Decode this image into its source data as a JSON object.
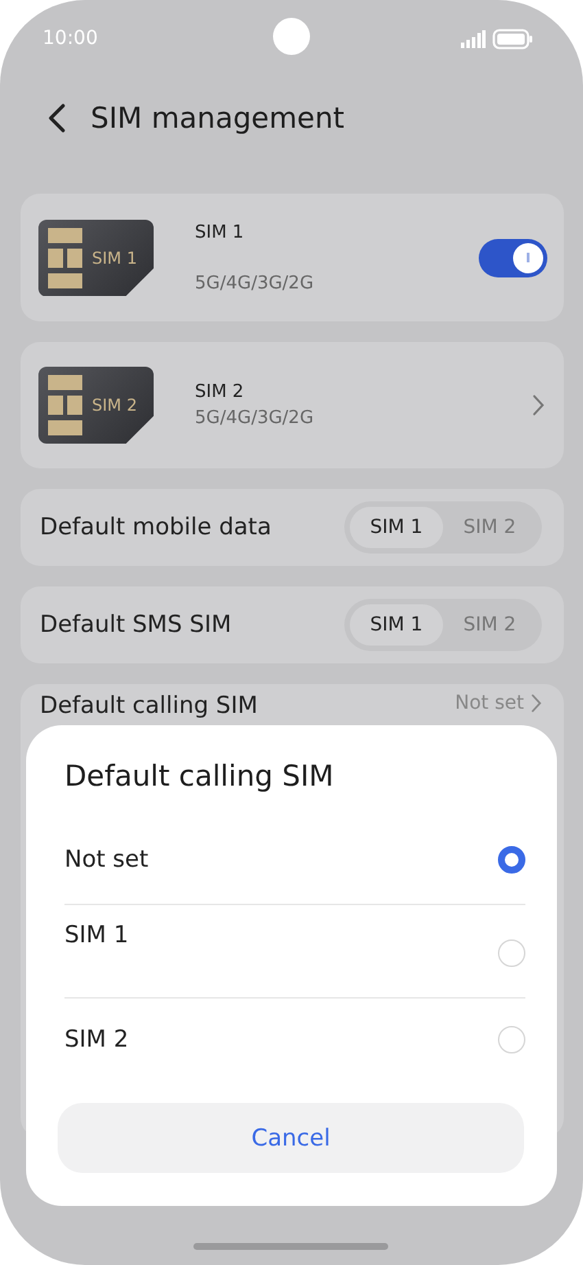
{
  "status_bar": {
    "time": "10:00"
  },
  "header": {
    "title": "SIM management"
  },
  "sims": [
    {
      "kind": "toggle",
      "card_label": "SIM 1",
      "name": "SIM 1",
      "network": "5G/4G/3G/2G",
      "on": true
    },
    {
      "kind": "link",
      "card_label": "SIM 2",
      "name": "SIM 2",
      "network": "5G/4G/3G/2G"
    }
  ],
  "defaults": [
    {
      "kind": "segmented",
      "label": "Default mobile data",
      "options": [
        {
          "label": "SIM 1",
          "selected": true
        },
        {
          "label": "SIM 2",
          "selected": false
        }
      ]
    },
    {
      "kind": "segmented",
      "label": "Default SMS SIM",
      "options": [
        {
          "label": "SIM 1",
          "selected": true
        },
        {
          "label": "SIM 2",
          "selected": false
        }
      ]
    },
    {
      "kind": "link",
      "label": "Default calling SIM",
      "value": "Not set"
    }
  ],
  "dialog": {
    "title": "Default calling SIM",
    "options": [
      {
        "label": "Not set",
        "selected": true
      },
      {
        "label": "SIM 1",
        "selected": false
      },
      {
        "label": "SIM 2",
        "selected": false
      }
    ],
    "cancel": "Cancel"
  }
}
